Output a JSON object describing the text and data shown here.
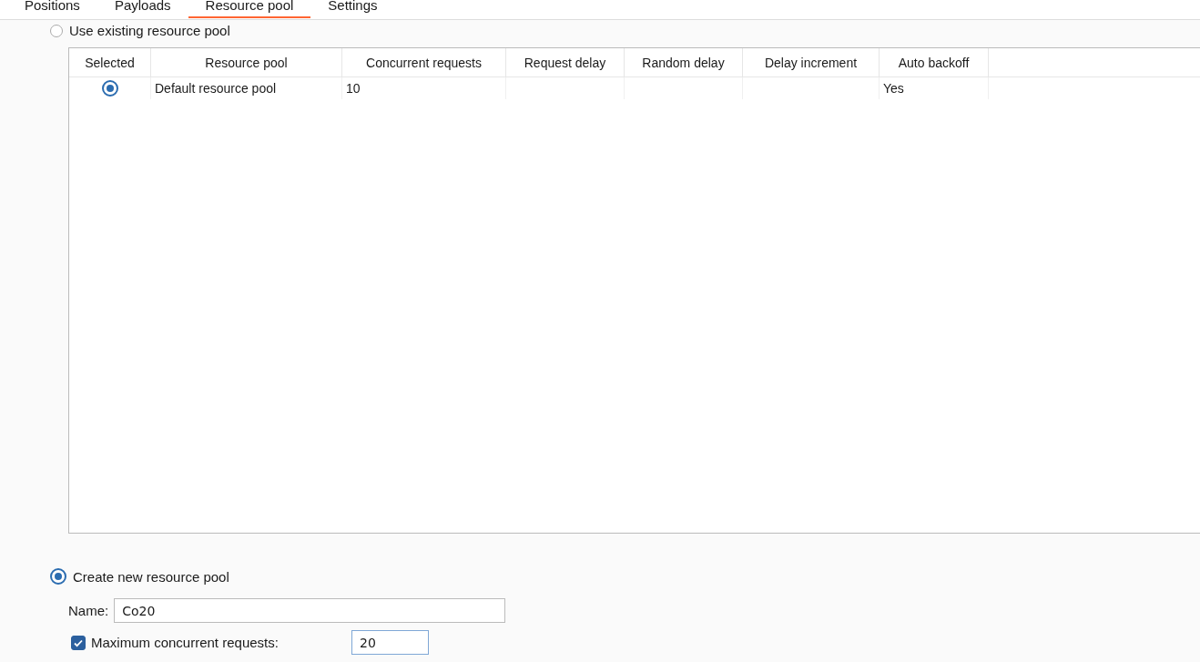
{
  "tabs": [
    {
      "label": "Positions",
      "selected": false
    },
    {
      "label": "Payloads",
      "selected": false
    },
    {
      "label": "Resource pool",
      "selected": true
    },
    {
      "label": "Settings",
      "selected": false
    }
  ],
  "use_existing": {
    "label": "Use existing resource pool",
    "selected": false
  },
  "table": {
    "columns": [
      "Selected",
      "Resource pool",
      "Concurrent requests",
      "Request delay",
      "Random delay",
      "Delay increment",
      "Auto backoff"
    ],
    "rows": [
      {
        "selected": true,
        "cells": [
          "",
          "Default resource pool",
          "10",
          "",
          "",
          "",
          "Yes"
        ]
      }
    ]
  },
  "create_new": {
    "label": "Create new resource pool",
    "selected": true
  },
  "name_field": {
    "label": "Name:",
    "value": "Co20"
  },
  "max_concurrent": {
    "label": "Maximum concurrent requests:",
    "checked": true,
    "value": "20"
  }
}
